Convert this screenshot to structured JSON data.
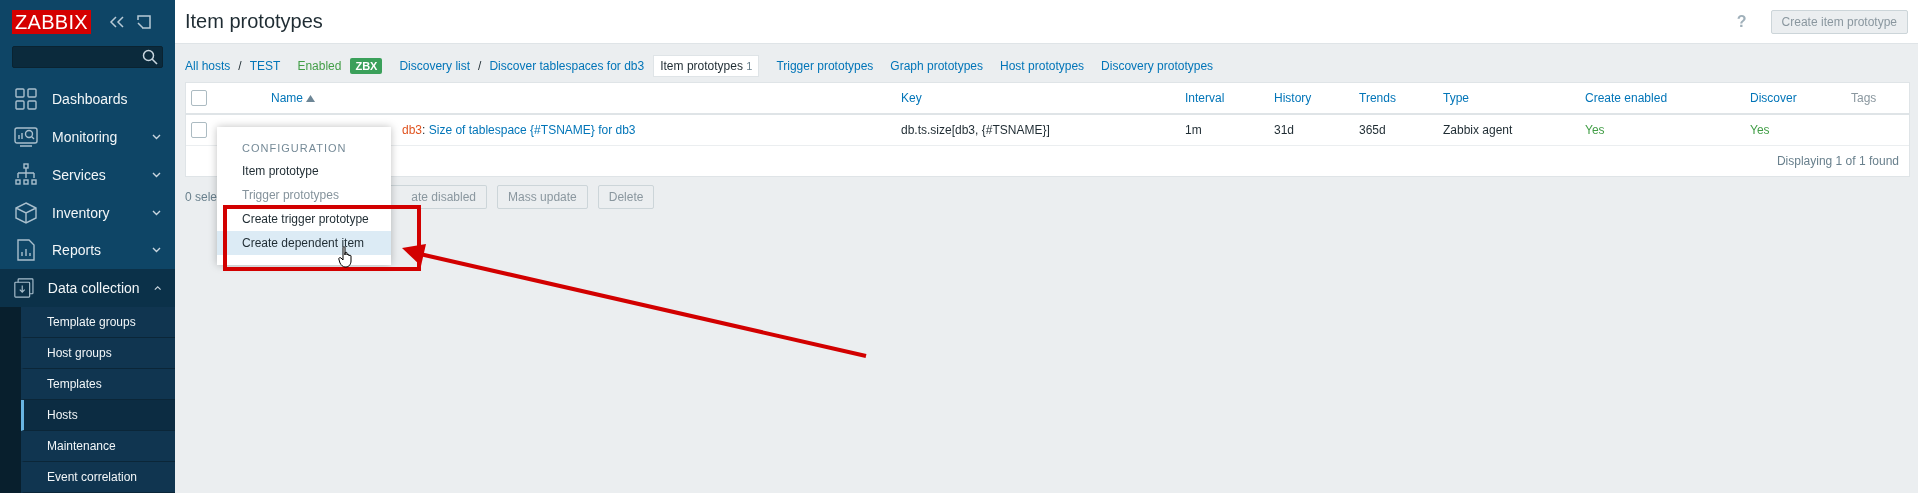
{
  "sidebar": {
    "logo": "ZABBIX",
    "menu": [
      {
        "label": "Dashboards",
        "expanded": false,
        "has_arrow": false
      },
      {
        "label": "Monitoring",
        "expanded": false,
        "has_arrow": true
      },
      {
        "label": "Services",
        "expanded": false,
        "has_arrow": true
      },
      {
        "label": "Inventory",
        "expanded": false,
        "has_arrow": true
      },
      {
        "label": "Reports",
        "expanded": false,
        "has_arrow": true
      },
      {
        "label": "Data collection",
        "expanded": true,
        "has_arrow": true
      }
    ],
    "submenu": [
      {
        "label": "Template groups",
        "selected": false
      },
      {
        "label": "Host groups",
        "selected": false
      },
      {
        "label": "Templates",
        "selected": false
      },
      {
        "label": "Hosts",
        "selected": true
      },
      {
        "label": "Maintenance",
        "selected": false
      },
      {
        "label": "Event correlation",
        "selected": false
      }
    ]
  },
  "header": {
    "title": "Item prototypes",
    "help": "?",
    "create_button": {
      "label": "Create item prototype",
      "disabled": true
    }
  },
  "breadcrumbs": [
    {
      "kind": "link",
      "label": "All hosts"
    },
    {
      "kind": "sep",
      "label": "/"
    },
    {
      "kind": "link",
      "label": "TEST"
    },
    {
      "kind": "status",
      "label": "Enabled"
    },
    {
      "kind": "badge",
      "label": "ZBX"
    },
    {
      "kind": "link",
      "label": "Discovery list"
    },
    {
      "kind": "sep",
      "label": "/"
    },
    {
      "kind": "link",
      "label": "Discover tablespaces for db3"
    },
    {
      "kind": "tab",
      "label": "Item prototypes",
      "count": "1",
      "selected": true
    },
    {
      "kind": "link",
      "label": "Trigger prototypes"
    },
    {
      "kind": "link",
      "label": "Graph prototypes"
    },
    {
      "kind": "link",
      "label": "Host prototypes"
    },
    {
      "kind": "link",
      "label": "Discovery prototypes"
    }
  ],
  "table": {
    "select_all_checked": false,
    "columns": [
      {
        "label": "Name",
        "sorted": true,
        "link": true
      },
      {
        "label": "Key",
        "sorted": false,
        "link": true
      },
      {
        "label": "Interval",
        "sorted": false,
        "link": true
      },
      {
        "label": "History",
        "sorted": false,
        "link": true
      },
      {
        "label": "Trends",
        "sorted": false,
        "link": true
      },
      {
        "label": "Type",
        "sorted": false,
        "link": true
      },
      {
        "label": "Create enabled",
        "sorted": false,
        "link": true
      },
      {
        "label": "Discover",
        "sorted": false,
        "link": true
      },
      {
        "label": "Tags",
        "sorted": false,
        "link": false
      }
    ],
    "rows": [
      {
        "checked": false,
        "name_prefix": "db3",
        "name_separator": ":",
        "name": "Size of tablespace {#TSNAME} for db3",
        "key": "db.ts.size[db3, {#TSNAME}]",
        "interval": "1m",
        "history": "31d",
        "trends": "365d",
        "type": "Zabbix agent",
        "create_enabled": "Yes",
        "discover": "Yes"
      }
    ],
    "footer": "Displaying 1 of 1 found"
  },
  "actions": {
    "selected_count": "0 sele",
    "buttons": [
      {
        "label": "ate disabled",
        "disabled": true
      },
      {
        "label": "Mass update",
        "disabled": true
      },
      {
        "label": "Delete",
        "disabled": true
      }
    ]
  },
  "context_menu": {
    "items": [
      {
        "kind": "header",
        "label": "CONFIGURATION"
      },
      {
        "kind": "item",
        "label": "Item prototype",
        "disabled": false,
        "selected": false
      },
      {
        "kind": "item",
        "label": "Trigger prototypes",
        "disabled": true,
        "selected": false
      },
      {
        "kind": "item",
        "label": "Create trigger prototype",
        "disabled": false,
        "selected": false
      },
      {
        "kind": "item",
        "label": "Create dependent item",
        "disabled": false,
        "selected": true
      }
    ]
  }
}
